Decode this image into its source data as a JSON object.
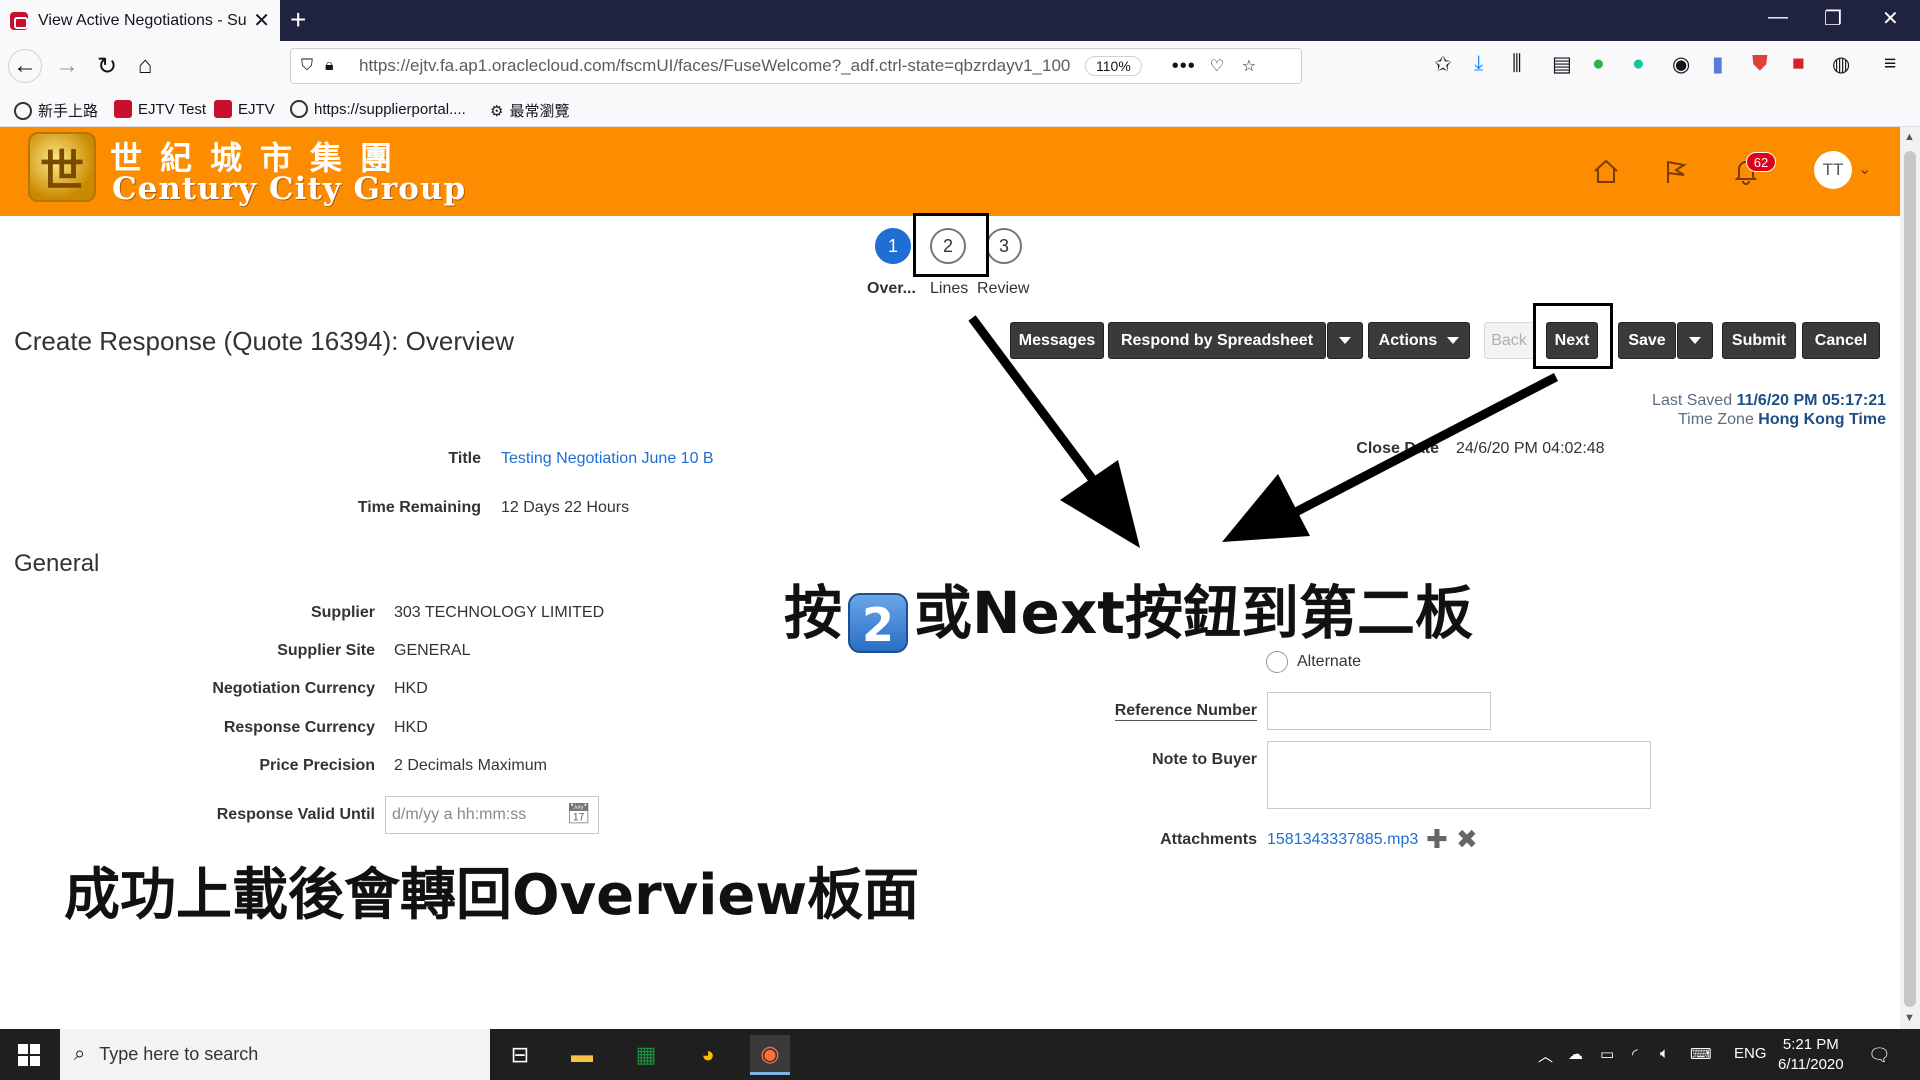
{
  "browser": {
    "tab_title": "View Active Negotiations - Sup",
    "url": "https://ejtv.fa.ap1.oraclecloud.com/fscmUI/faces/FuseWelcome?_adf.ctrl-state=qbzrdayv1_100",
    "zoom": "110%",
    "bookmarks": [
      "新手上路",
      "EJTV Test",
      "EJTV",
      "https://supplierportal....",
      "最常瀏覽"
    ]
  },
  "header": {
    "logo_cn": "世紀城市集團",
    "logo_en": "Century City Group",
    "notification_count": "62",
    "user_initials": "TT"
  },
  "train": {
    "steps": [
      {
        "num": "1",
        "label": "Over..."
      },
      {
        "num": "2",
        "label": "Lines"
      },
      {
        "num": "3",
        "label": "Review"
      }
    ]
  },
  "page": {
    "title": "Create Response (Quote 16394): Overview"
  },
  "toolbar": {
    "messages": "Messages",
    "respond_spreadsheet": "Respond by Spreadsheet",
    "actions": "Actions",
    "back": "Back",
    "next": "Next",
    "save": "Save",
    "submit": "Submit",
    "cancel": "Cancel"
  },
  "meta": {
    "last_saved_label": "Last Saved",
    "last_saved_value": "11/6/20 PM 05:17:21",
    "timezone_label": "Time Zone",
    "timezone_value": "Hong Kong Time"
  },
  "form": {
    "title_label": "Title",
    "title_value": "Testing Negotiation June 10 B",
    "time_remaining_label": "Time Remaining",
    "time_remaining_value": "12 Days 22 Hours",
    "close_date_label": "Close Date",
    "close_date_value": "24/6/20 PM 04:02:48",
    "general_heading": "General",
    "supplier_label": "Supplier",
    "supplier_value": "303 TECHNOLOGY LIMITED",
    "supplier_site_label": "Supplier Site",
    "supplier_site_value": "GENERAL",
    "neg_currency_label": "Negotiation Currency",
    "neg_currency_value": "HKD",
    "resp_currency_label": "Response Currency",
    "resp_currency_value": "HKD",
    "price_precision_label": "Price Precision",
    "price_precision_value": "2 Decimals Maximum",
    "valid_until_label": "Response Valid Until",
    "valid_until_placeholder": "d/m/yy a hh:mm:ss",
    "alternate_label": "Alternate",
    "reference_label": "Reference Number",
    "note_label": "Note to Buyer",
    "attachments_label": "Attachments",
    "attachment_file": "1581343337885.mp3"
  },
  "annotations": {
    "caption_top_a": "按",
    "caption_top_key": "2",
    "caption_top_b": "或Next按鈕到第二板",
    "caption_bottom": "成功上載後會轉回Overview板面"
  },
  "taskbar": {
    "search_placeholder": "Type here to search",
    "language": "ENG",
    "time": "5:21 PM",
    "date": "6/11/2020"
  },
  "colors": {
    "header_orange": "#fc8d00",
    "primary_blue": "#1f6ed4",
    "button_dark": "#3a3a3a"
  }
}
